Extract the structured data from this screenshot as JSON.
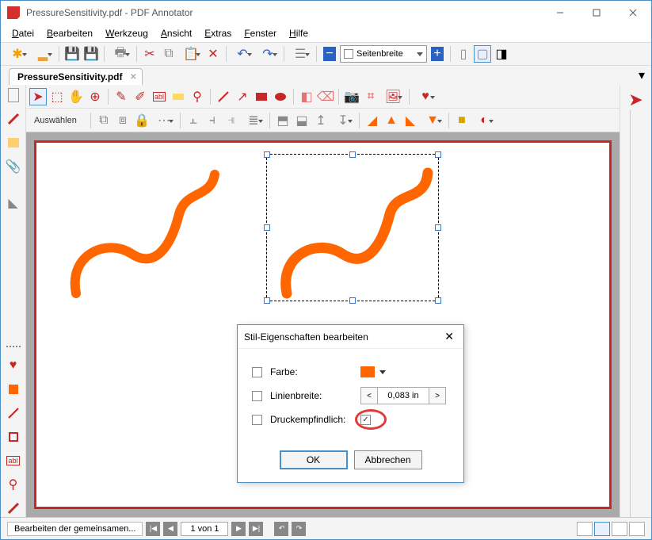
{
  "window": {
    "title": "PressureSensitivity.pdf - PDF Annotator"
  },
  "menubar": [
    "Datei",
    "Bearbeiten",
    "Werkzeug",
    "Ansicht",
    "Extras",
    "Fenster",
    "Hilfe"
  ],
  "toolbar1": {
    "zoom_label": "Seitenbreite"
  },
  "document_tab": "PressureSensitivity.pdf",
  "tool_row2": {
    "label": "Auswählen"
  },
  "dialog": {
    "title": "Stil-Eigenschaften bearbeiten",
    "row_color": "Farbe:",
    "row_linewidth": "Linienbreite:",
    "row_pressure": "Druckempfindlich:",
    "linewidth_value": "0,083 in",
    "ok": "OK",
    "cancel": "Abbrechen",
    "color_value": "#ff6600",
    "pressure_checked": true
  },
  "statusbar": {
    "edit_common": "Bearbeiten der gemeinsamen...",
    "page_field": "1 von 1"
  }
}
